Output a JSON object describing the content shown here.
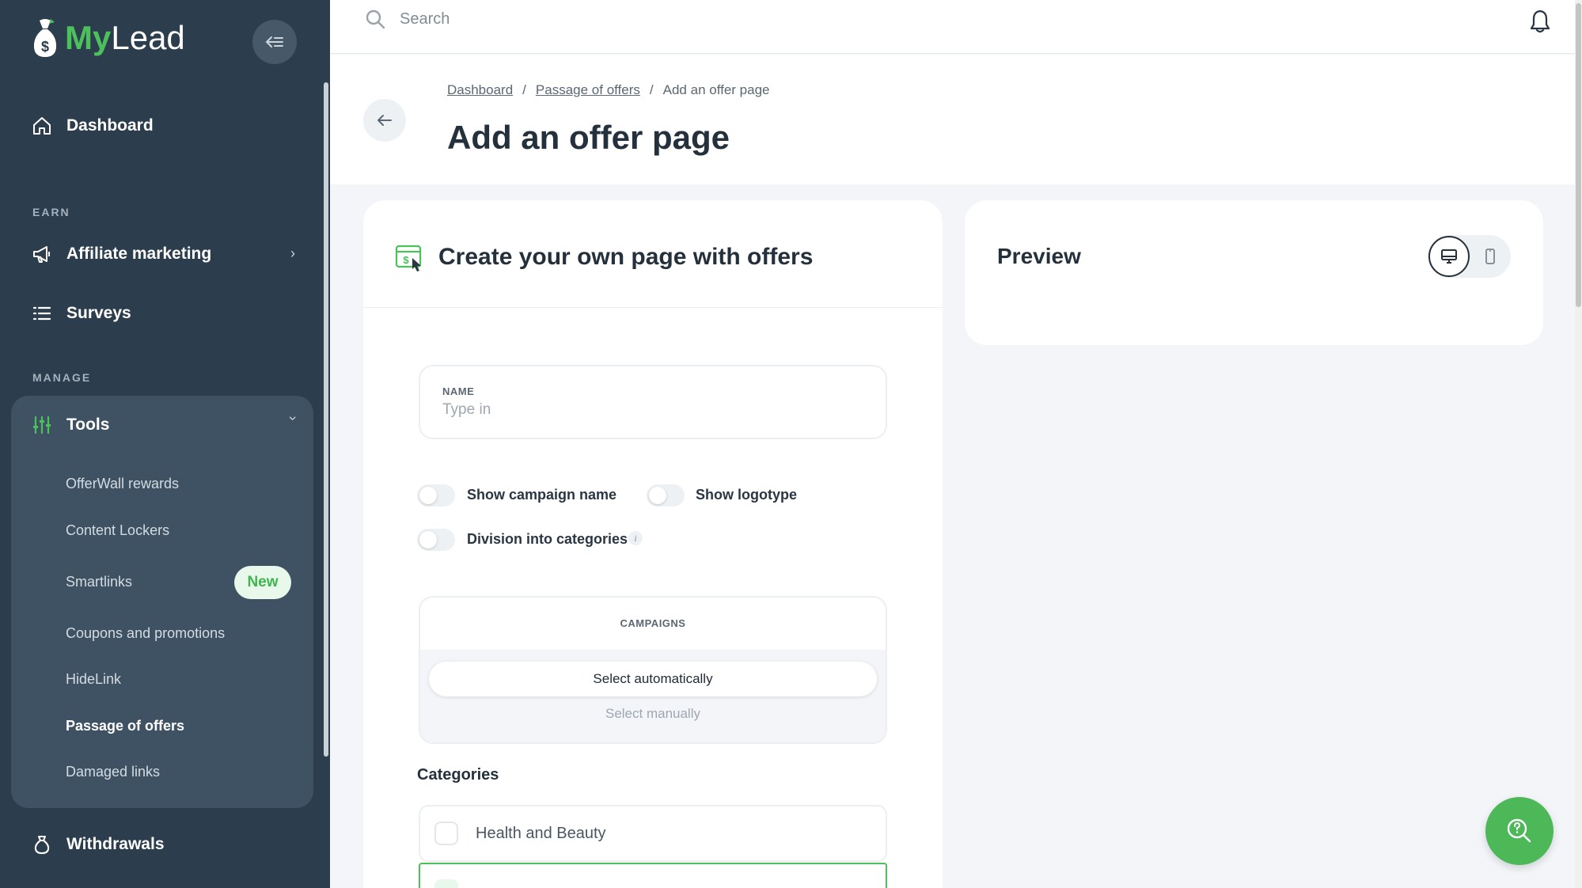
{
  "brand": {
    "name_my": "My",
    "name_lead": "Lead",
    "accent": "#4cc05a"
  },
  "sidebar": {
    "dashboard": "Dashboard",
    "section_earn": "EARN",
    "affiliate": "Affiliate marketing",
    "surveys": "Surveys",
    "section_manage": "MANAGE",
    "tools": "Tools",
    "tools_items": [
      "OfferWall rewards",
      "Content Lockers",
      "Smartlinks",
      "Coupons and promotions",
      "HideLink",
      "Passage of offers",
      "Damaged links"
    ],
    "new_badge": "New",
    "withdrawals": "Withdrawals"
  },
  "topbar": {
    "search_placeholder": "Search"
  },
  "breadcrumb": {
    "items": [
      "Dashboard",
      "Passage of offers",
      "Add an offer page"
    ],
    "separator": "/"
  },
  "page": {
    "title": "Add an offer page"
  },
  "form": {
    "title": "Create your own page with offers",
    "name_label": "NAME",
    "name_placeholder": "Type in",
    "toggles": {
      "show_campaign_name": "Show campaign name",
      "show_logotype": "Show logotype",
      "division_categories": "Division into categories"
    },
    "info_glyph": "i",
    "campaigns_label": "CAMPAIGNS",
    "select_auto": "Select automatically",
    "select_manual": "Select manually",
    "categories_title": "Categories",
    "categories": [
      "Health and Beauty"
    ]
  },
  "preview": {
    "title": "Preview"
  }
}
